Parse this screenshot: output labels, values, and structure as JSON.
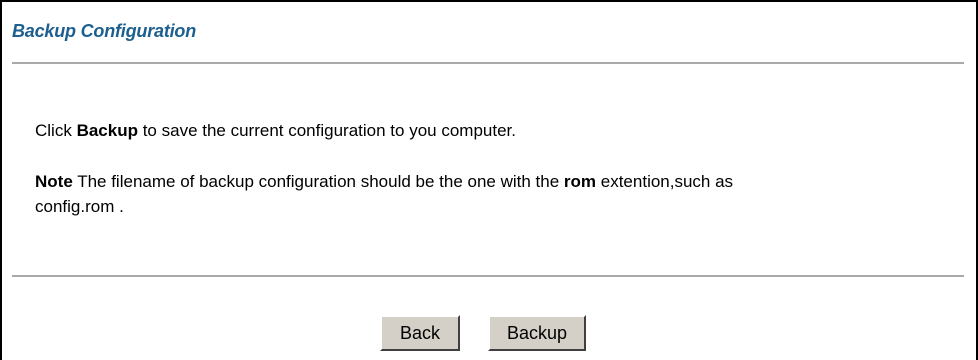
{
  "page": {
    "title": "Backup Configuration"
  },
  "instructions": {
    "line1_prefix": "Click ",
    "line1_bold": "Backup",
    "line1_suffix": " to save the current configuration to you computer.",
    "note_label": "Note",
    "note_text_before": " The filename of backup configuration should be the one with the ",
    "note_bold": "rom",
    "note_text_after": " extention,such as",
    "note_line2": "config.rom ."
  },
  "buttons": {
    "back_label": "Back",
    "backup_label": "Backup"
  },
  "colors": {
    "title": "#1d5f8e",
    "rule": "#a9a9a9",
    "button_face": "#d4d0c8"
  }
}
